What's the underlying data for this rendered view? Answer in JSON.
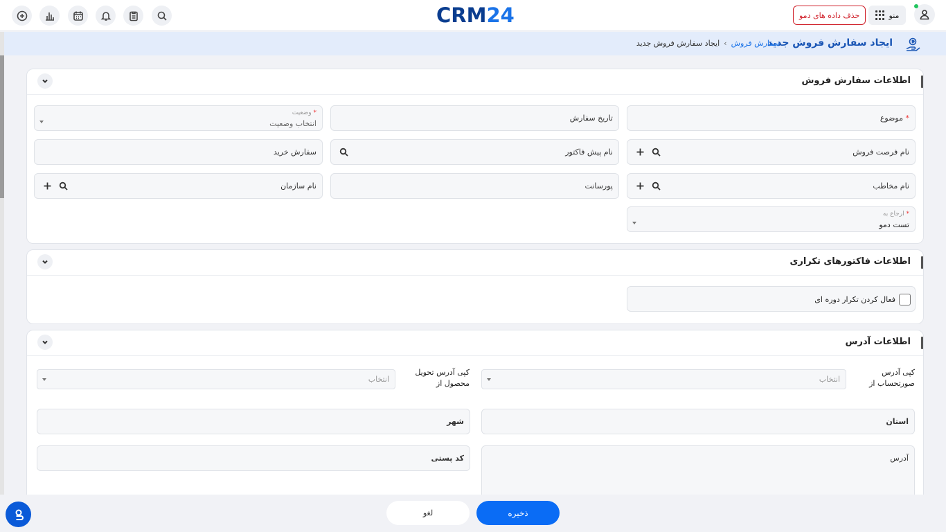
{
  "topbar": {
    "logo_crm": "CRM",
    "logo_num": "24",
    "delete_demo_label": "حذف داده های دمو",
    "menu_label": "منو"
  },
  "breadcrumb": {
    "title": "ایجاد سفارش فروش جدید",
    "link": "سفارش فروش",
    "separator": "›",
    "current": "ایجاد سفارش فروش جدید"
  },
  "sections": {
    "sales_order": {
      "title": "اطلاعات سفارش فروش",
      "subject_label": "موضوع",
      "required_mark": "*",
      "order_date_label": "تاریخ سفارش",
      "status_label": "وضعیت",
      "status_placeholder": "انتخاب وضعیت",
      "opportunity_label": "نام فرصت فروش",
      "proforma_label": "نام پیش فاکتور",
      "purchase_order_label": "سفارش خرید",
      "contact_label": "نام مخاطب",
      "commission_label": "پورسانت",
      "organization_label": "نام سازمان",
      "assigned_to_label": "ارجاع به",
      "assigned_to_value": "تست دمو"
    },
    "recurring": {
      "title": "اطلاعات فاکتورهای تکراری",
      "enable_label": "فعال کردن تکرار دوره ای"
    },
    "address": {
      "title": "اطلاعات آدرس",
      "copy_billing_label_1": "کپی آدرس",
      "copy_billing_label_2": "صورتحساب از",
      "copy_shipping_label_1": "کپی آدرس تحویل",
      "copy_shipping_label_2": "محصول از",
      "select_placeholder": "انتخاب",
      "province_label": "استان",
      "city_label": "شهر",
      "address_label": "آدرس",
      "postal_code_label": "کد پستی"
    }
  },
  "footer": {
    "save_label": "ذخیره",
    "cancel_label": "لغو"
  },
  "colors": {
    "primary": "#0a6cf5",
    "brand_dark": "#0a3d8f",
    "danger": "#d0202a"
  }
}
